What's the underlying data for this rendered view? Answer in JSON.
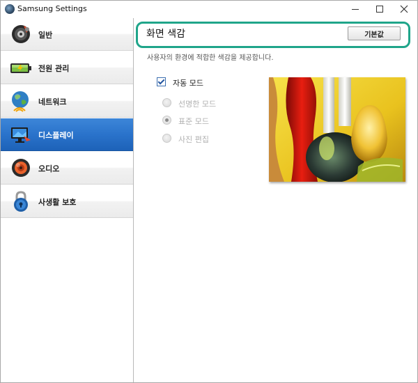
{
  "window": {
    "title": "Samsung Settings",
    "controls": [
      "minimize",
      "maximize",
      "close"
    ]
  },
  "sidebar": {
    "active_index": 3,
    "items": [
      {
        "label": "일반",
        "icon": "speaker-gear-icon"
      },
      {
        "label": "전원 관리",
        "icon": "battery-icon"
      },
      {
        "label": "네트워크",
        "icon": "globe-wifi-icon"
      },
      {
        "label": "디스플레이",
        "icon": "monitor-icon"
      },
      {
        "label": "오디오",
        "icon": "speaker-icon"
      },
      {
        "label": "사생활 보호",
        "icon": "lock-icon"
      }
    ]
  },
  "main": {
    "section_title": "화면 색감",
    "default_button": "기본값",
    "description": "사용자의 환경에 적합한 색감을 제공합니다.",
    "auto_mode": {
      "label": "자동 모드",
      "checked": true
    },
    "modes": [
      {
        "label": "선명한 모드",
        "selected": false
      },
      {
        "label": "표준 모드",
        "selected": true
      },
      {
        "label": "사진 편집",
        "selected": false
      }
    ],
    "highlight_color": "#1fa58a",
    "active_color": "#2a73cb"
  }
}
